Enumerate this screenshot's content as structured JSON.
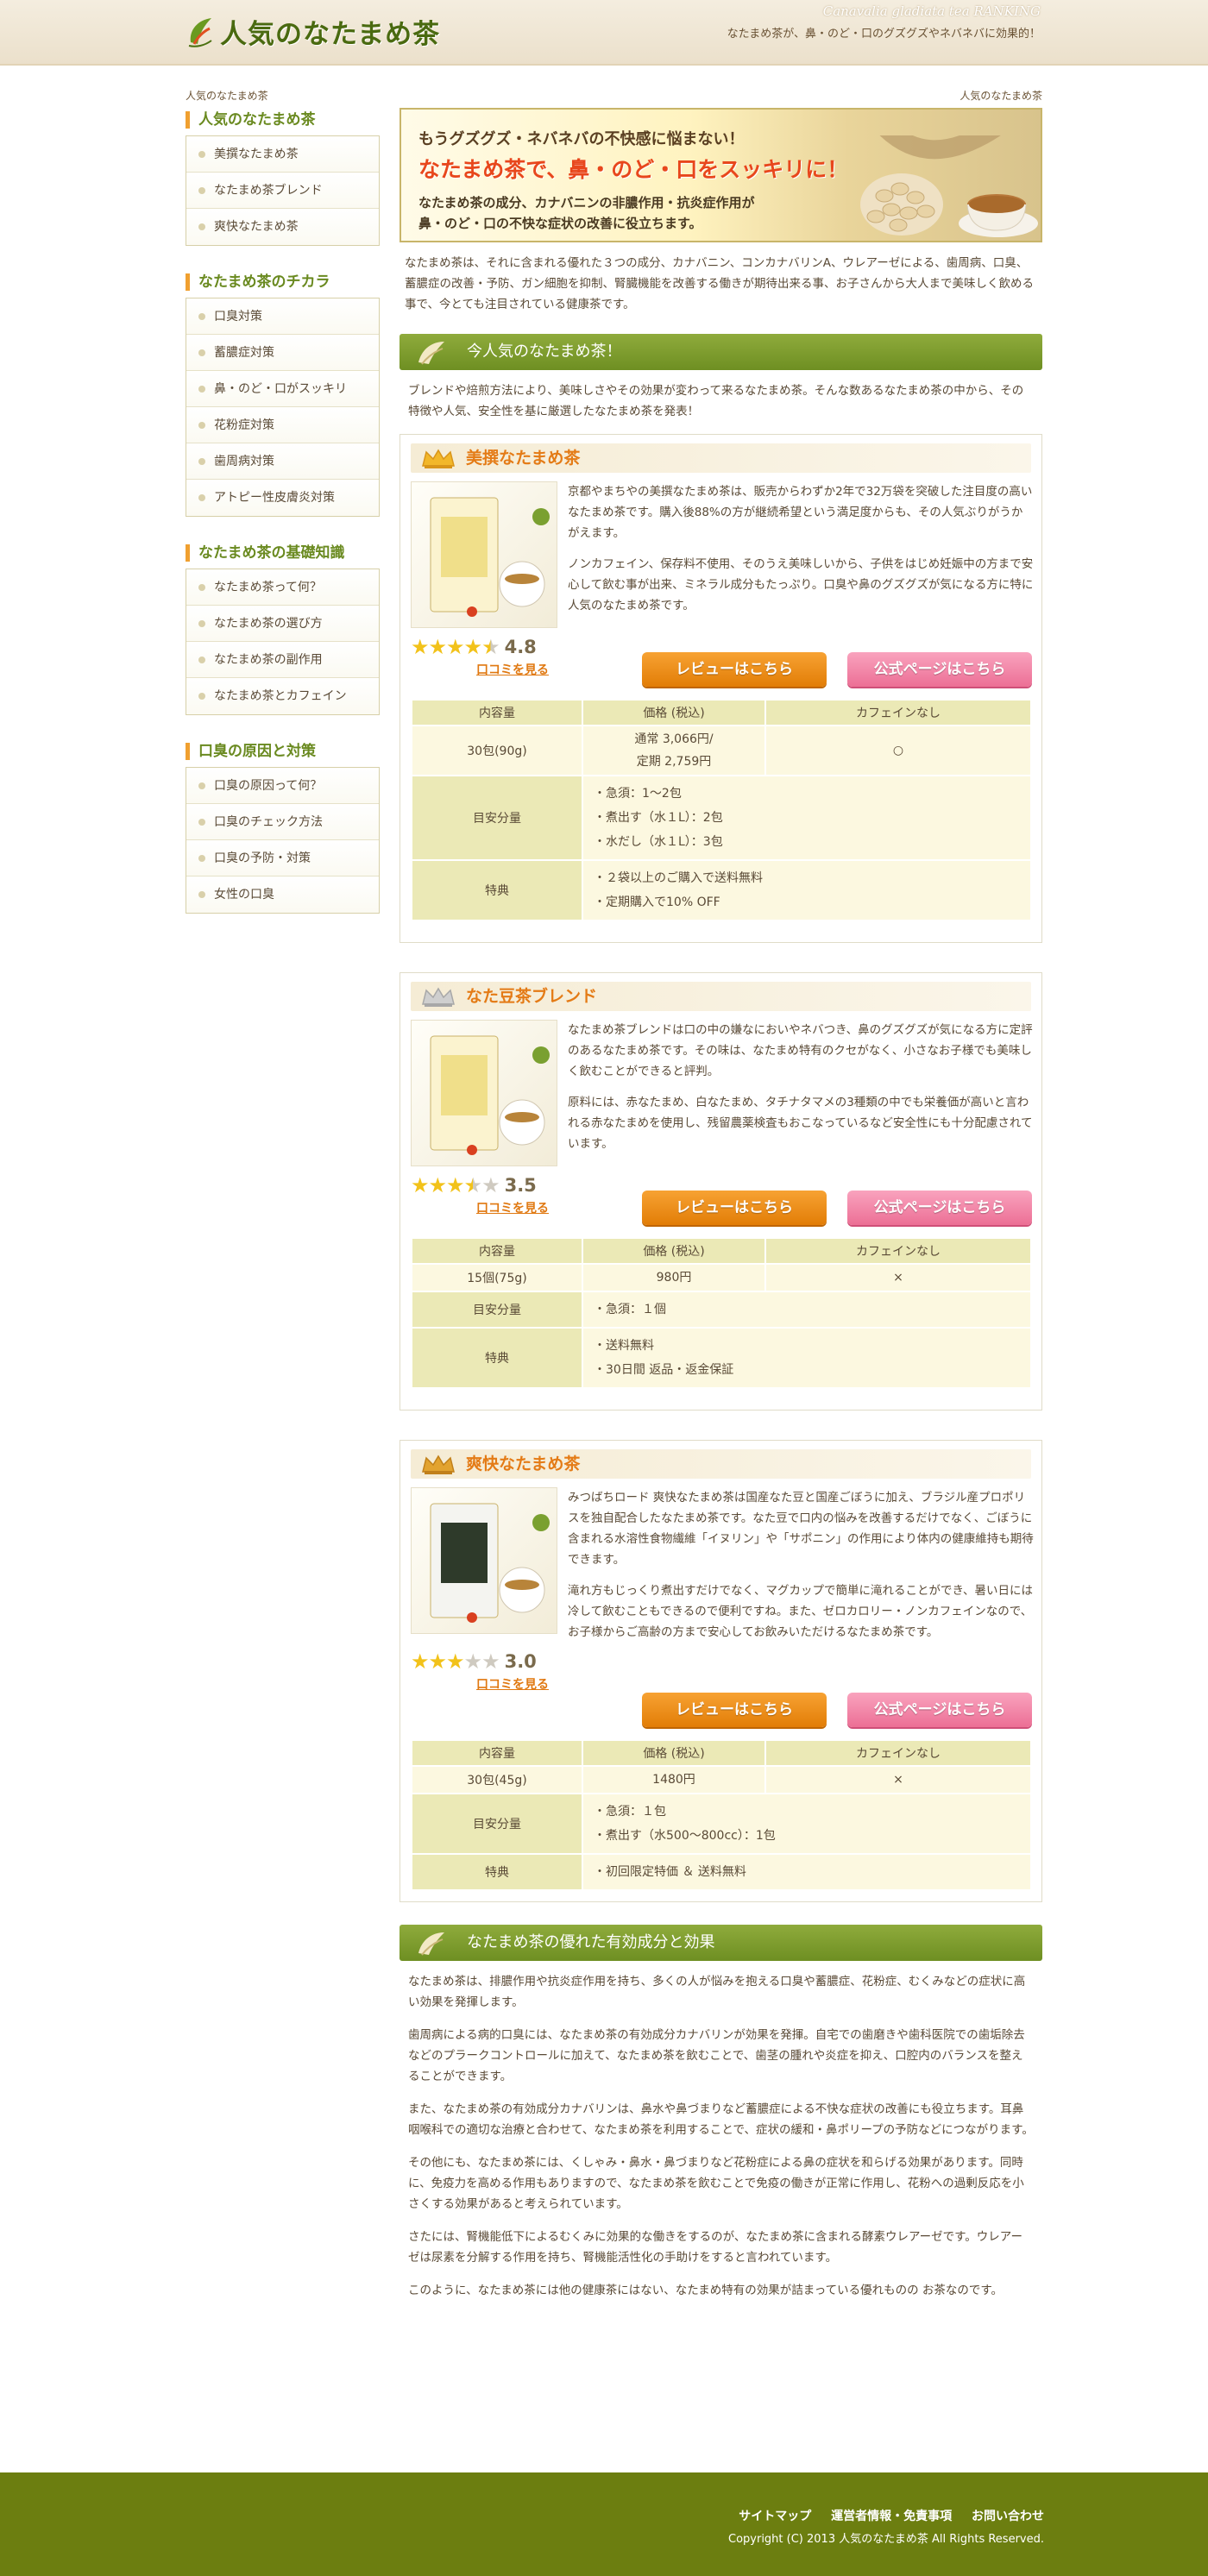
{
  "header": {
    "logo": "人気のなたまめ茶",
    "tagline_en": "Canavalia gladiata tea RANKING",
    "tagline": "なたまめ茶が、鼻・のど・口のグズグズやネバネバに効果的！"
  },
  "sidebar": {
    "breadcrumb": "人気のなたまめ茶",
    "sections": [
      {
        "title": "人気のなたまめ茶",
        "items": [
          "美撰なたまめ茶",
          "なたまめ茶ブレンド",
          "爽快なたまめ茶"
        ]
      },
      {
        "title": "なたまめ茶のチカラ",
        "items": [
          "口臭対策",
          "蓄膿症対策",
          "鼻・のど・口がスッキリ",
          "花粉症対策",
          "歯周病対策",
          "アトピー性皮膚炎対策"
        ]
      },
      {
        "title": "なたまめ茶の基礎知識",
        "items": [
          "なたまめ茶って何？",
          "なたまめ茶の選び方",
          "なたまめ茶の副作用",
          "なたまめ茶とカフェイン"
        ]
      },
      {
        "title": "口臭の原因と対策",
        "items": [
          "口臭の原因って何？",
          "口臭のチェック方法",
          "口臭の予防・対策",
          "女性の口臭"
        ]
      }
    ]
  },
  "main": {
    "breadcrumb": "人気のなたまめ茶",
    "banner": {
      "line1": "もうグズグズ・ネバネバの不快感に悩まない！",
      "line2": "なたまめ茶で、鼻・のど・口をスッキリに！",
      "line3": "なたまめ茶の成分、カナバニンの非膿作用・抗炎症作用が",
      "line4": "鼻・のど・口の不快な症状の改善に役立ちます。"
    },
    "intro": "なたまめ茶は、それに含まれる優れた３つの成分、カナバニン、コンカナバリンA、ウレアーゼによる、歯周病、口臭、蓄膿症の改善・予防、ガン細胞を抑制、腎臓機能を改善する働きが期待出来る事、お子さんから大人まで美味しく飲める事で、今とても注目されている健康茶です。",
    "ranking_title": "今人気のなたまめ茶！",
    "ranking_intro": "ブレンドや焙煎方法により、美味しさやその効果が変わって来るなたまめ茶。そんな数あるなたまめ茶の中から、その特徴や人気、安全性を基に厳選したなたまめ茶を発表！",
    "labels": {
      "review": "レビューはこちら",
      "official": "公式ページはこちら",
      "kuchikomi": "口コミを見る",
      "col_amount": "内容量",
      "col_price": "価格 (税込)",
      "col_caffeine": "カフェインなし",
      "row_guide": "目安分量",
      "row_bonus": "特典"
    },
    "products": [
      {
        "name": "美撰なたまめ茶",
        "desc1": "京都やまちやの美撰なたまめ茶は、販売からわずか2年で32万袋を突破した注目度の高いなたまめ茶です。購入後88%の方が継続希望という満足度からも、その人気ぶりがうかがえます。",
        "desc2": "ノンカフェイン、保存料不使用、そのうえ美味しいから、子供をはじめ妊娠中の方まで安心して飲む事が出来、ミネラル成分もたっぷり。口臭や鼻のグズグズが気になる方に特に人気のなたまめ茶です。",
        "rating": 4.8,
        "score": "4.8",
        "amount": "30包(90g)",
        "price1": "通常 3,066円/",
        "price2": "定期 2,759円",
        "caffeine": "○",
        "guide": [
          "・急須：1〜2包",
          "・煮出す（水１L）：2包",
          "・水だし（水１L）：3包"
        ],
        "bonus": [
          "・２袋以上のご購入で送料無料",
          "・定期購入で10% OFF"
        ]
      },
      {
        "name": "なた豆茶ブレンド",
        "desc1": "なたまめ茶ブレンドは口の中の嫌なにおいやネバつき、鼻のグズグズが気になる方に定評のあるなたまめ茶です。その味は、なたまめ特有のクセがなく、小さなお子様でも美味しく飲むことができると評判。",
        "desc2": "原料には、赤なたまめ、白なたまめ、タチナタマメの3種類の中でも栄養価が高いと言われる赤なたまめを使用し、残留農薬検査もおこなっているなど安全性にも十分配慮されています。",
        "rating": 3.5,
        "score": "3.5",
        "amount": "15個(75g)",
        "price1": "980円",
        "price2": "",
        "caffeine": "×",
        "guide": [
          "・急須：１個"
        ],
        "bonus": [
          "・送料無料",
          "・30日間 返品・返金保証"
        ]
      },
      {
        "name": "爽快なたまめ茶",
        "desc1": "みつばちロード 爽快なたまめ茶は国産なた豆と国産ごぼうに加え、ブラジル産プロポリスを独自配合したなたまめ茶です。なた豆で口内の悩みを改善するだけでなく、ごぼうに含まれる水溶性食物繊維「イヌリン」や「サポニン」の作用により体内の健康維持も期待できます。",
        "desc2": "滝れ方もじっくり煮出すだけでなく、マグカップで簡単に滝れることができ、暑い日には冷して飲むこともできるので便利ですね。また、ゼロカロリー・ノンカフェインなので、お子様からご高齢の方まで安心してお飲みいただけるなたまめ茶です。",
        "rating": 3.0,
        "score": "3.0",
        "amount": "30包(45g)",
        "price1": "1480円",
        "price2": "",
        "caffeine": "×",
        "guide": [
          "・急須：１包",
          "・煮出す（水500〜800cc）：1包"
        ],
        "bonus": [
          "・初回限定特価 ＆ 送料無料"
        ]
      }
    ],
    "effects_title": "なたまめ茶の優れた有効成分と効果",
    "effects": [
      "なたまめ茶は、排膿作用や抗炎症作用を持ち、多くの人が悩みを抱える口臭や蓄膿症、花粉症、むくみなどの症状に高い効果を発揮します。",
      "歯周病による病的口臭には、なたまめ茶の有効成分カナバリンが効果を発揮。自宅での歯磨きや歯科医院での歯垢除去などのプラークコントロールに加えて、なたまめ茶を飲むことで、歯茎の腫れや炎症を抑え、口腔内のバランスを整えることができます。",
      "また、なたまめ茶の有効成分カナバリンは、鼻水や鼻づまりなど蓄膿症による不快な症状の改善にも役立ちます。耳鼻咽喉科での適切な治療と合わせて、なたまめ茶を利用することで、症状の緩和・鼻ポリープの予防などにつながります。",
      "その他にも、なたまめ茶には、くしゃみ・鼻水・鼻づまりなど花粉症による鼻の症状を和らげる効果があります。同時に、免疫力を高める作用もありますので、なたまめ茶を飲むことで免疫の働きが正常に作用し、花粉への過剰反応を小さくする効果があると考えられています。",
      "さたには、腎機能低下によるむくみに効果的な働きをするのが、なたまめ茶に含まれる酵素ウレアーゼです。ウレアーゼは尿素を分解する作用を持ち、腎機能活性化の手助けをすると言われています。",
      "このように、なたまめ茶には他の健康茶にはない、なたまめ特有の効果が詰まっている優れものの お茶なのです。"
    ]
  },
  "footer": {
    "links": [
      "サイトマップ",
      "運営者情報・免責事項",
      "お問い合わせ"
    ],
    "copyright": "Copyright (C) 2013 人気のなたまめ茶 All Rights Reserved."
  },
  "colors": {
    "accent_green": "#6e8f22",
    "accent_orange": "#e47b16",
    "pink_button": "#ec6f95",
    "footer": "#6c7e10"
  },
  "icons": [
    "leaf-icon",
    "crown-gold-icon",
    "crown-silver-icon",
    "crown-bronze-icon",
    "star-icon",
    "bullet-icon"
  ]
}
